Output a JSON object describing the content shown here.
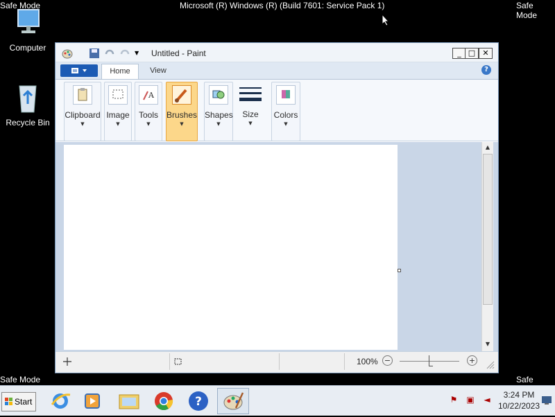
{
  "desktop": {
    "safe_mode_label": "Safe Mode",
    "build_text": "Microsoft (R) Windows (R) (Build 7601: Service Pack 1)",
    "icons": [
      {
        "label": "Computer",
        "icon": "computer-icon"
      },
      {
        "label": "Recycle Bin",
        "icon": "recycle-bin-icon"
      }
    ]
  },
  "window": {
    "title": "Untitled - Paint",
    "controls": {
      "minimize": "_",
      "maximize": "□",
      "close": "✕"
    },
    "tabs": [
      {
        "label": "Home"
      },
      {
        "label": "View"
      }
    ],
    "help": "?",
    "ribbon_groups": [
      {
        "label": "Clipboard",
        "icon": "clipboard-icon",
        "arrow": "▼"
      },
      {
        "label": "Image",
        "icon": "select-icon",
        "arrow": "▼"
      },
      {
        "label": "Tools",
        "icon": "tools-icon",
        "arrow": "▼"
      },
      {
        "label": "Brushes",
        "icon": "brush-icon",
        "arrow": "▼",
        "selected": true
      },
      {
        "label": "Shapes",
        "icon": "shapes-icon",
        "arrow": "▼"
      },
      {
        "label": "Size",
        "icon": "size-icon",
        "arrow": "▼"
      },
      {
        "label": "Colors",
        "icon": "colors-icon",
        "arrow": "▼"
      }
    ],
    "status": {
      "zoom": "100%",
      "zoom_out": "−",
      "zoom_in": "+"
    },
    "scroll_up": "▲",
    "scroll_down": "▼"
  },
  "taskbar": {
    "start_label": "Start",
    "apps": [
      {
        "icon": "internet-explorer-icon"
      },
      {
        "icon": "media-player-icon"
      },
      {
        "icon": "file-explorer-icon"
      },
      {
        "icon": "chrome-icon"
      },
      {
        "icon": "help-icon"
      },
      {
        "icon": "paint-icon",
        "active": true
      }
    ],
    "clock_time": "3:24 PM",
    "clock_date": "10/22/2023"
  },
  "colors": {
    "desktop": "#000000",
    "accent": "#1c5bb4",
    "selected": "#fcd78a"
  }
}
